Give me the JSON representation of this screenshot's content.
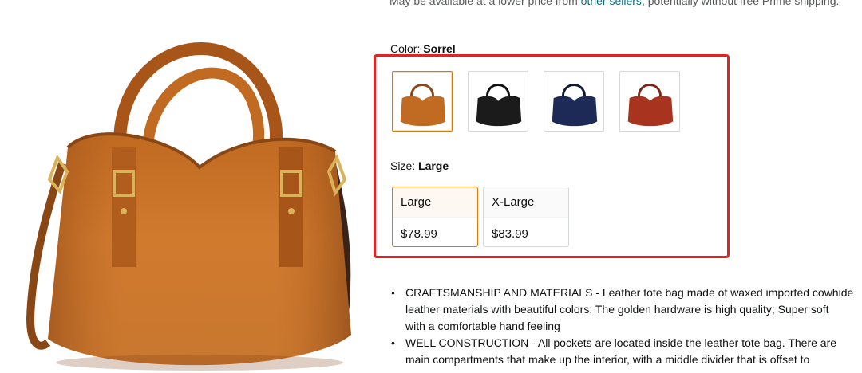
{
  "top_note": {
    "prefix": "May be available at a lower price from ",
    "link": "other sellers",
    "suffix": ", potentially without free Prime shipping."
  },
  "color": {
    "label": "Color: ",
    "selected": "Sorrel",
    "options": [
      {
        "name": "Sorrel",
        "hex": "#b8621f"
      },
      {
        "name": "Black",
        "hex": "#1b1b1b"
      },
      {
        "name": "Navy",
        "hex": "#1c2a55"
      },
      {
        "name": "Red",
        "hex": "#a8331f"
      }
    ]
  },
  "size": {
    "label": "Size: ",
    "selected": "Large",
    "options": [
      {
        "name": "Large",
        "price": "$78.99"
      },
      {
        "name": "X-Large",
        "price": "$83.99"
      }
    ]
  },
  "bullets": [
    {
      "line1": "CRAFTSMANSHIP AND MATERIALS - Leather tote bag made of waxed imported cowhide",
      "line2": "leather materials with beautiful colors; The golden hardware is high quality; Super soft",
      "line3": "with a comfortable hand feeling"
    },
    {
      "line1": "WELL CONSTRUCTION - All pockets are located inside the leather tote bag. There are",
      "line2": "main compartments that make up the interior, with a middle divider that is offset to"
    }
  ],
  "colors": {
    "selected_border": "#e77600",
    "highlight_box": "#e02424",
    "link": "#007185"
  }
}
